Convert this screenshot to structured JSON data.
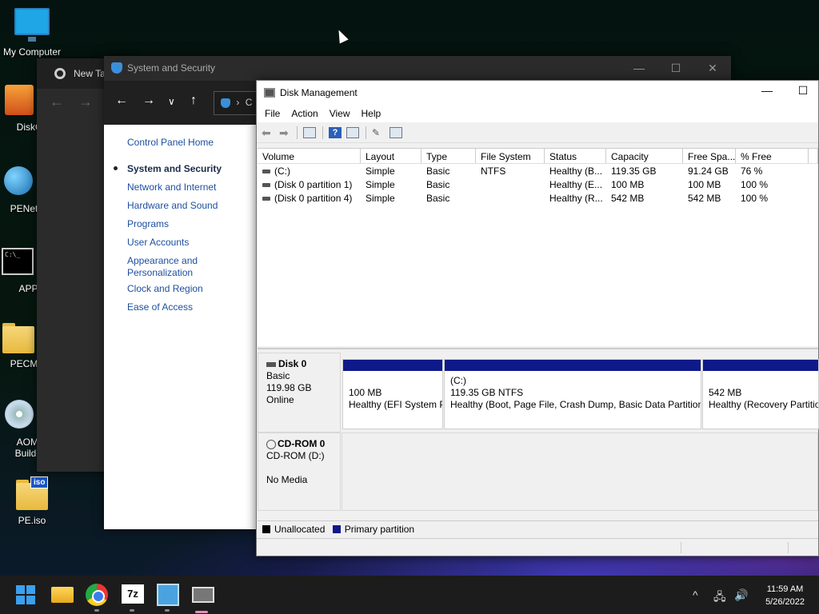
{
  "desktop": {
    "icons": [
      {
        "label": "My Computer",
        "icon": "monitor-icon"
      },
      {
        "label": "DiskGe",
        "icon": "diskgenius-icon"
      },
      {
        "label": "PENetw",
        "icon": "network-globe-icon"
      },
      {
        "label": "APP.e",
        "icon": "cmd-icon"
      },
      {
        "label": "PECMD",
        "icon": "folder-icon"
      },
      {
        "label": "AOME\nBuilder",
        "icon": "cd-icon"
      },
      {
        "label": "PE.iso",
        "icon": "iso-file-icon"
      }
    ]
  },
  "chrome_window": {
    "tab_title": "New Ta"
  },
  "control_panel": {
    "title": "System and Security",
    "address_fragment": "C",
    "sidebar": [
      {
        "label": "Control Panel Home",
        "current": false
      },
      {
        "label": "System and Security",
        "current": true
      },
      {
        "label": "Network and Internet",
        "current": false
      },
      {
        "label": "Hardware and Sound",
        "current": false
      },
      {
        "label": "Programs",
        "current": false
      },
      {
        "label": "User Accounts",
        "current": false
      },
      {
        "label": "Appearance and\nPersonalization",
        "current": false
      },
      {
        "label": "Clock and Region",
        "current": false
      },
      {
        "label": "Ease of Access",
        "current": false
      }
    ]
  },
  "disk_management": {
    "title": "Disk Management",
    "menu": [
      "File",
      "Action",
      "View",
      "Help"
    ],
    "columns": [
      "Volume",
      "Layout",
      "Type",
      "File System",
      "Status",
      "Capacity",
      "Free Spa...",
      "% Free"
    ],
    "volumes": [
      {
        "volume": "(C:)",
        "layout": "Simple",
        "type": "Basic",
        "fs": "NTFS",
        "status": "Healthy (B...",
        "capacity": "119.35 GB",
        "free": "91.24 GB",
        "pct": "76 %"
      },
      {
        "volume": "(Disk 0 partition 1)",
        "layout": "Simple",
        "type": "Basic",
        "fs": "",
        "status": "Healthy (E...",
        "capacity": "100 MB",
        "free": "100 MB",
        "pct": "100 %"
      },
      {
        "volume": "(Disk 0 partition 4)",
        "layout": "Simple",
        "type": "Basic",
        "fs": "",
        "status": "Healthy (R...",
        "capacity": "542 MB",
        "free": "542 MB",
        "pct": "100 %"
      }
    ],
    "disk0": {
      "name": "Disk 0",
      "type": "Basic",
      "size": "119.98 GB",
      "state": "Online",
      "partitions": [
        {
          "name": "",
          "size": "100 MB",
          "status": "Healthy (EFI System P"
        },
        {
          "name": "(C:)",
          "size": "119.35 GB NTFS",
          "status": "Healthy (Boot, Page File, Crash Dump, Basic Data Partition)"
        },
        {
          "name": "",
          "size": "542 MB",
          "status": "Healthy (Recovery Partition)"
        }
      ]
    },
    "cdrom0": {
      "name": "CD-ROM 0",
      "drive": "CD-ROM (D:)",
      "media": "No Media"
    },
    "legend": {
      "unallocated": "Unallocated",
      "primary": "Primary partition",
      "unallocated_color": "#000000",
      "primary_color": "#0e1a8a"
    }
  },
  "taskbar": {
    "apps": [
      "start-icon",
      "file-explorer-icon",
      "chrome-icon",
      "7zip-icon",
      "control-panel-icon",
      "disk-management-icon"
    ],
    "time": "11:59 AM",
    "date": "5/26/2022"
  }
}
